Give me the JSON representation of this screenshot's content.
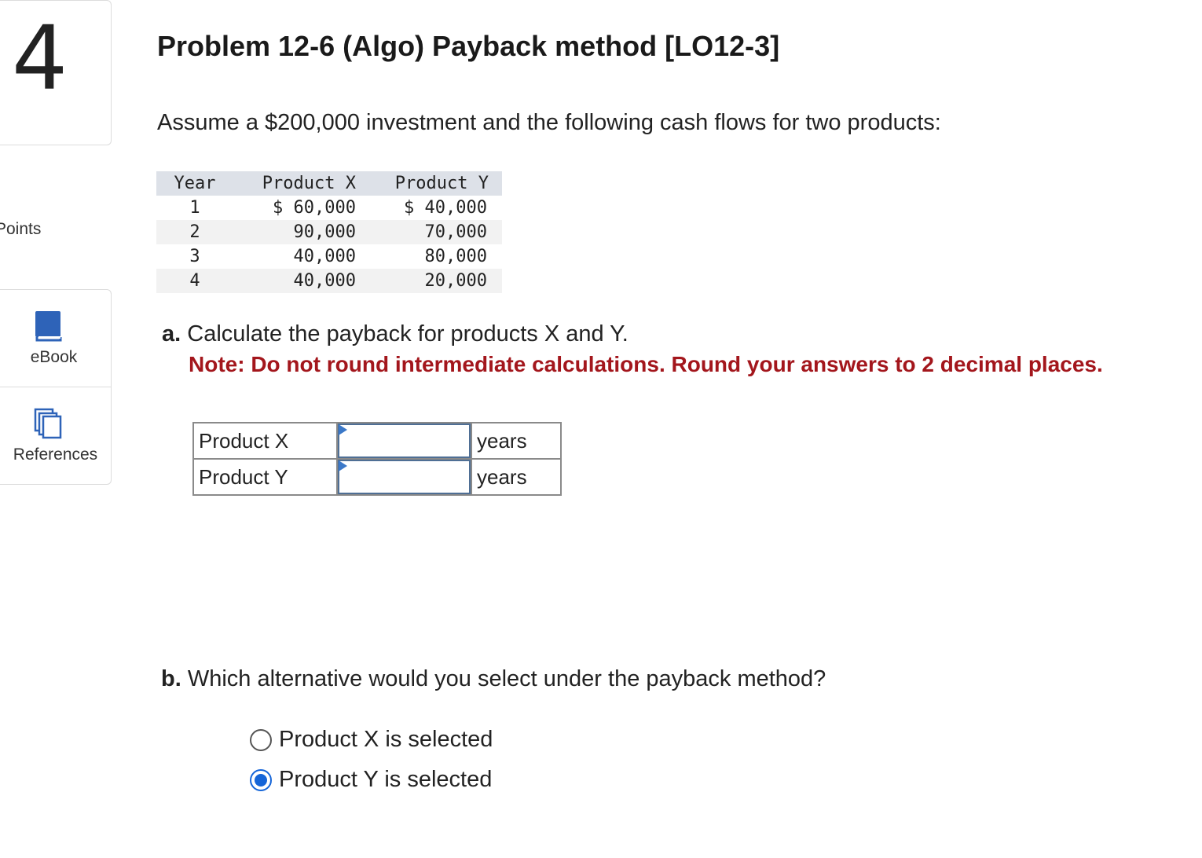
{
  "question": {
    "number": "4",
    "points_label": "Points"
  },
  "tools": {
    "ebook_label": "eBook",
    "references_label": "References"
  },
  "problem": {
    "title": "Problem 12-6 (Algo) Payback method [LO12-3]",
    "intro": "Assume a $200,000 investment and the following cash flows for two products:"
  },
  "cash_flows": {
    "headers": [
      "Year",
      "Product X",
      "Product Y"
    ],
    "rows": [
      [
        "1",
        "$ 60,000",
        "$ 40,000"
      ],
      [
        "2",
        "90,000",
        "70,000"
      ],
      [
        "3",
        "40,000",
        "80,000"
      ],
      [
        "4",
        "40,000",
        "20,000"
      ]
    ]
  },
  "part_a": {
    "letter": "a.",
    "text": "Calculate the payback for products X and Y.",
    "note": "Note: Do not round intermediate calculations. Round your answers to 2 decimal places.",
    "rows": [
      {
        "label": "Product X",
        "value": "",
        "unit": "years"
      },
      {
        "label": "Product Y",
        "value": "",
        "unit": "years"
      }
    ]
  },
  "part_b": {
    "letter": "b.",
    "text": "Which alternative would you select under the payback method?",
    "options": [
      {
        "label": "Product X is selected",
        "selected": false
      },
      {
        "label": "Product Y is selected",
        "selected": true
      }
    ]
  },
  "colors": {
    "note_red": "#a3161c",
    "radio_blue": "#1565d8",
    "icon_blue": "#2e63b8",
    "table_header_bg": "#dde1e8"
  }
}
